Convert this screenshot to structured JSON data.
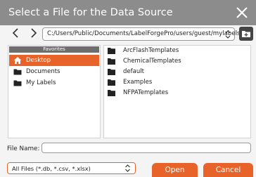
{
  "window": {
    "title": "Select a File for the Data Source"
  },
  "nav": {
    "path": "C:/Users/Public/Documents/LabelForgePro/users/guest/mylabels"
  },
  "sidebar": {
    "header": "Favorites",
    "items": [
      {
        "label": "Desktop",
        "icon": "home-icon",
        "selected": true
      },
      {
        "label": "Documents",
        "icon": "folder-icon",
        "selected": false
      },
      {
        "label": "My Labels",
        "icon": "folder-icon",
        "selected": false
      }
    ]
  },
  "files": [
    {
      "name": "ArcFlashTemplates",
      "icon": "folder-icon"
    },
    {
      "name": "ChemicalTemplates",
      "icon": "folder-icon"
    },
    {
      "name": "default",
      "icon": "folder-icon"
    },
    {
      "name": "Examples",
      "icon": "folder-icon"
    },
    {
      "name": "NFPATemplates",
      "icon": "folder-icon"
    }
  ],
  "filename": {
    "label": "File Name:",
    "value": ""
  },
  "filter": {
    "selected": "All Files (*.db, *.csv, *.xlsx)"
  },
  "buttons": {
    "open": "Open",
    "cancel": "Cancel"
  },
  "colors": {
    "titlebar": "#8c8c8c",
    "accent": "#e8632a",
    "sidebar_header": "#6e6e6e"
  }
}
